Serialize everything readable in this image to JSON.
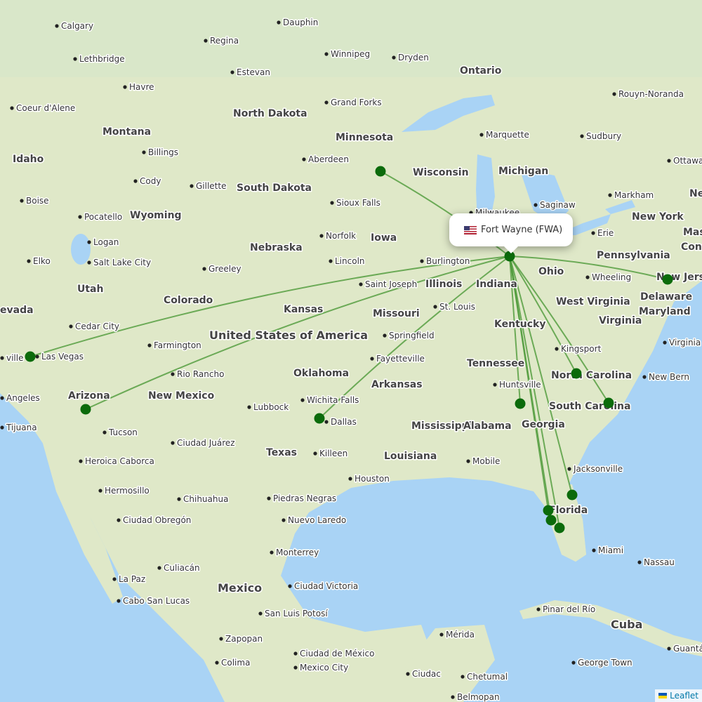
{
  "map": {
    "colors": {
      "land": "#dfe8c8",
      "water": "#a9d3f5",
      "route": "#4e9a3a",
      "marker": "#0b6b0b"
    },
    "popup": {
      "flag_icon": "us-flag-icon",
      "label": "Fort Wayne (FWA)"
    },
    "attribution": {
      "label": "Leaflet",
      "flag_icon": "ukraine-flag-icon"
    },
    "countries": [
      "United States of America",
      "Mexico",
      "Cuba"
    ],
    "regions": [
      "North Dakota",
      "Montana",
      "Idaho",
      "Minnesota",
      "Wisconsin",
      "Michigan",
      "Ontario",
      "South Dakota",
      "Wyoming",
      "Iowa",
      "Nebraska",
      "Utah",
      "Colorado",
      "Kansas",
      "Illinois",
      "Indiana",
      "Ohio",
      "Pennsylvania",
      "New York",
      "Missouri",
      "Kentucky",
      "West Virginia",
      "Virginia",
      "Maryland",
      "Delaware",
      "New Jersey",
      "Tennessee",
      "North Carolina",
      "South Carolina",
      "Oklahoma",
      "Arkansas",
      "Arizona",
      "New Mexico",
      "Texas",
      "Louisiana",
      "Mississippi",
      "Alabama",
      "Georgia",
      "Florida",
      "evada",
      "Mas",
      "Conn",
      "Ne"
    ],
    "cities": [
      "Calgary",
      "Lethbridge",
      "Regina",
      "Dauphin",
      "Winnipeg",
      "Dryden",
      "Estevan",
      "Havre",
      "Coeur d'Alene",
      "Grand Forks",
      "Marquette",
      "Sudbury",
      "Rouyn-Noranda",
      "Billings",
      "Aberdeen",
      "Ottawa",
      "Cody",
      "Gillette",
      "Boise",
      "Sioux Falls",
      "Saginaw",
      "Markham",
      "Pocatello",
      "Milwaukee",
      "Erie",
      "Norfolk",
      "Logan",
      "Elko",
      "Salt Lake City",
      "Greeley",
      "Lincoln",
      "Burlington",
      "Wheeling",
      "Saint Joseph",
      "St. Louis",
      "Cedar City",
      "Springfield",
      "Kingsport",
      "Virginia Be",
      "Farmington",
      "Las Vegas",
      "ville",
      "Fayetteville",
      "Rio Rancho",
      "Huntsville",
      "New Bern",
      "Angeles",
      "Lubbock",
      "Wichita Falls",
      "Dallas",
      "Tijuana",
      "Tucson",
      "Ciudad Juárez",
      "Killeen",
      "Heroica Caborca",
      "Mobile",
      "Jacksonville",
      "Houston",
      "Hermosillo",
      "Chihuahua",
      "Piedras Negras",
      "Ciudad Obregón",
      "Nuevo Laredo",
      "Miami",
      "Monterrey",
      "Nassau",
      "Culiacán",
      "La Paz",
      "Ciudad Victoria",
      "Cabo San Lucas",
      "Pinar del Río",
      "San Luis Potosí",
      "Mérida",
      "Zapopan",
      "Ciudad de México",
      "Mexico City",
      "George Town",
      "Guantá",
      "Colima",
      "Ciudac",
      "Chetumal",
      "Belmopan"
    ]
  }
}
